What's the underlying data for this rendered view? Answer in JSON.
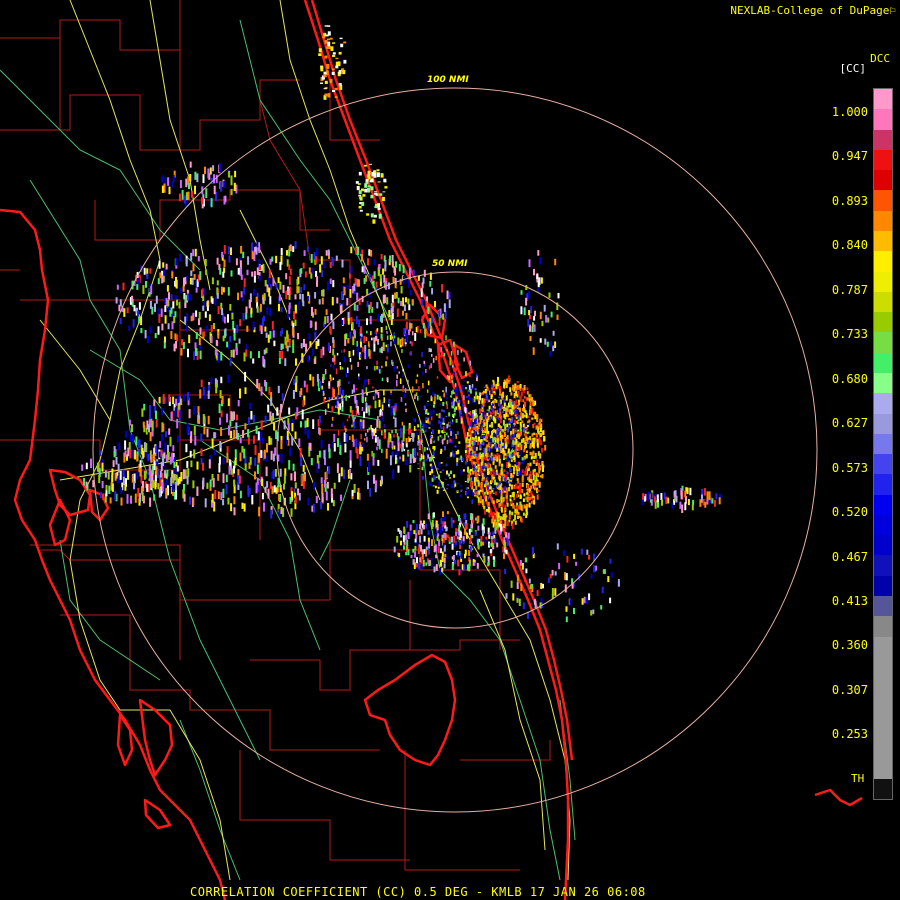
{
  "header": {
    "credit": "NEXLAB-College of DuPage"
  },
  "colorbar": {
    "product_code": "DCC",
    "unit": "[CC]",
    "end_label": "TH",
    "ticks": [
      "1.000",
      "0.947",
      "0.893",
      "0.840",
      "0.787",
      "0.733",
      "0.680",
      "0.627",
      "0.573",
      "0.520",
      "0.467",
      "0.413",
      "0.360",
      "0.307",
      "0.253"
    ],
    "swatches": [
      "#ff99cc",
      "#ff77bb",
      "#cc3366",
      "#ee1111",
      "#dd0000",
      "#ff5500",
      "#ff8800",
      "#ffbb00",
      "#ffee00",
      "#eeee00",
      "#ccdd00",
      "#99cc00",
      "#77dd44",
      "#44ee66",
      "#88ff88",
      "#aaaaee",
      "#9999dd",
      "#7777ee",
      "#4444ee",
      "#2222ee",
      "#0000ee",
      "#0000dd",
      "#0000cc",
      "#1111bb",
      "#0000aa",
      "#555599",
      "#888888",
      "#999999",
      "#999999",
      "#999999",
      "#999999",
      "#999999",
      "#999999",
      "#999999",
      "#111111"
    ]
  },
  "range_rings": [
    {
      "label": "50 NMI",
      "nmi": 50
    },
    {
      "label": "100 NMI",
      "nmi": 100
    }
  ],
  "footer": {
    "caption": "CORRELATION COEFFICIENT (CC) 0.5 DEG - KMLB 17 JAN 26 06:08"
  },
  "colors": {
    "coast": "#ff1a1a",
    "county": "#cc2222",
    "roads": "#ffff66",
    "rivers": "#55cc77",
    "rings": "#e8b0a0",
    "text": "#ffff00"
  }
}
